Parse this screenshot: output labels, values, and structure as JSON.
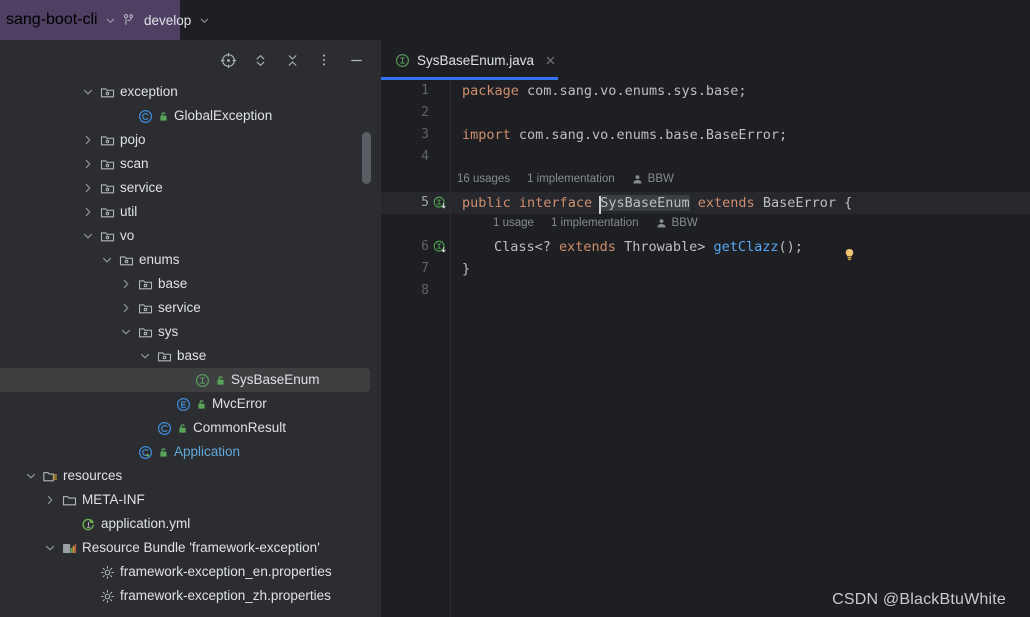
{
  "header": {
    "project_name": "sang-boot-cli",
    "project_icon": "chevron-down-icon",
    "branch_icon": "git-branch-icon",
    "branch_name": "develop",
    "branch_chevron": "chevron-down-icon"
  },
  "sidebar": {
    "toolbar": [
      {
        "name": "select-opened-file-icon",
        "title": "Select Opened File"
      },
      {
        "name": "expand-collapse-icon",
        "title": "Expand / Collapse"
      },
      {
        "name": "collapse-all-icon",
        "title": "Collapse All"
      },
      {
        "name": "more-options-icon",
        "title": "Options"
      },
      {
        "name": "hide-tool-window-icon",
        "title": "Hide"
      }
    ],
    "tree": [
      {
        "label": "exception",
        "icon": "package-icon",
        "twisty": "down",
        "indent": 4,
        "selected": false,
        "badge": null,
        "accent": false
      },
      {
        "label": "GlobalException",
        "icon": "class-icon",
        "twisty": "none",
        "indent": 6,
        "selected": false,
        "badge": "public-badge-icon",
        "accent": false
      },
      {
        "label": "pojo",
        "icon": "package-icon",
        "twisty": "right",
        "indent": 4,
        "selected": false,
        "badge": null,
        "accent": false
      },
      {
        "label": "scan",
        "icon": "package-icon",
        "twisty": "right",
        "indent": 4,
        "selected": false,
        "badge": null,
        "accent": false
      },
      {
        "label": "service",
        "icon": "package-icon",
        "twisty": "right",
        "indent": 4,
        "selected": false,
        "badge": null,
        "accent": false
      },
      {
        "label": "util",
        "icon": "package-icon",
        "twisty": "right",
        "indent": 4,
        "selected": false,
        "badge": null,
        "accent": false
      },
      {
        "label": "vo",
        "icon": "package-icon",
        "twisty": "down",
        "indent": 4,
        "selected": false,
        "badge": null,
        "accent": false
      },
      {
        "label": "enums",
        "icon": "package-icon",
        "twisty": "down",
        "indent": 5,
        "selected": false,
        "badge": null,
        "accent": false
      },
      {
        "label": "base",
        "icon": "package-icon",
        "twisty": "right",
        "indent": 6,
        "selected": false,
        "badge": null,
        "accent": false
      },
      {
        "label": "service",
        "icon": "package-icon",
        "twisty": "right",
        "indent": 6,
        "selected": false,
        "badge": null,
        "accent": false
      },
      {
        "label": "sys",
        "icon": "package-icon",
        "twisty": "down",
        "indent": 6,
        "selected": false,
        "badge": null,
        "accent": false
      },
      {
        "label": "base",
        "icon": "package-icon",
        "twisty": "down",
        "indent": 7,
        "selected": false,
        "badge": null,
        "accent": false
      },
      {
        "label": "SysBaseEnum",
        "icon": "interface-icon",
        "twisty": "none",
        "indent": 9,
        "selected": true,
        "badge": "public-badge-icon",
        "accent": false
      },
      {
        "label": "MvcError",
        "icon": "enum-icon",
        "twisty": "none",
        "indent": 8,
        "selected": false,
        "badge": "public-badge-icon",
        "accent": false
      },
      {
        "label": "CommonResult",
        "icon": "class-icon",
        "twisty": "none",
        "indent": 7,
        "selected": false,
        "badge": "public-badge-icon",
        "accent": false
      },
      {
        "label": "Application",
        "icon": "spring-class-icon",
        "twisty": "none",
        "indent": 6,
        "selected": false,
        "badge": "public-badge-icon",
        "accent": true
      },
      {
        "label": "resources",
        "icon": "resources-folder-icon",
        "twisty": "down",
        "indent": 1,
        "selected": false,
        "badge": null,
        "accent": false
      },
      {
        "label": "META-INF",
        "icon": "folder-icon",
        "twisty": "right",
        "indent": 2,
        "selected": false,
        "badge": null,
        "accent": false
      },
      {
        "label": "application.yml",
        "icon": "spring-yaml-icon",
        "twisty": "none",
        "indent": 3,
        "selected": false,
        "badge": null,
        "accent": false
      },
      {
        "label": "Resource Bundle 'framework-exception'",
        "icon": "resource-bundle-icon",
        "twisty": "down",
        "indent": 2,
        "selected": false,
        "badge": null,
        "accent": false
      },
      {
        "label": "framework-exception_en.properties",
        "icon": "properties-icon",
        "twisty": "none",
        "indent": 4,
        "selected": false,
        "badge": null,
        "accent": false
      },
      {
        "label": "framework-exception_zh.properties",
        "icon": "properties-icon",
        "twisty": "none",
        "indent": 4,
        "selected": false,
        "badge": null,
        "accent": false
      }
    ]
  },
  "editor": {
    "tab": {
      "label": "SysBaseEnum.java",
      "file_icon": "interface-icon",
      "close_icon": "close-icon",
      "active": true
    },
    "line_numbers": [
      "1",
      "2",
      "3",
      "4",
      "5",
      "6",
      "7",
      "8"
    ],
    "current_line": "5",
    "gutter_markers": [
      {
        "line": "5",
        "name": "implemented-by-icon"
      },
      {
        "line": "6",
        "name": "implemented-by-icon"
      }
    ],
    "code": {
      "line1_kw": "package",
      "line1_rest": " com.sang.vo.enums.sys.base;",
      "line3_kw": "import",
      "line3_rest": " com.sang.vo.enums.base.BaseError;",
      "line5_kw1": "public",
      "line5_kw2": "interface",
      "line5_ident": "SysBaseEnum",
      "line5_kw3": "extends",
      "line5_type": "BaseError",
      "line5_brace": "{",
      "line6_pre": "Class<? ",
      "line6_kw": "extends",
      "line6_mid": " Throwable> ",
      "line6_method": "getClazz",
      "line6_tail": "();",
      "line7": "}"
    },
    "inlay_hints": [
      {
        "line": "5",
        "usages": "16 usages",
        "implementations": "1 implementation",
        "author_icon": "person-icon",
        "author": "BBW",
        "bulb_icon": "intention-bulb-icon"
      },
      {
        "line": "6",
        "usages": "1 usage",
        "implementations": "1 implementation",
        "author_icon": "person-icon",
        "author": "BBW",
        "bulb_icon": null
      }
    ]
  },
  "watermark": "CSDN @BlackBtuWhite",
  "colors": {
    "header_purple": "#4e3f63",
    "sidebar_bg": "#2b2d30",
    "editor_bg": "#1e1f22",
    "selection_bg": "#3d3f41",
    "tab_accent": "#3574f0",
    "keyword": "#cf8e6d",
    "method": "#56a8f5",
    "text": "#bcbec4",
    "link_accent": "#61a8d8",
    "interface_green": "#57965c",
    "class_blue": "#3f8ddb",
    "bulb_yellow": "#f0c674"
  }
}
